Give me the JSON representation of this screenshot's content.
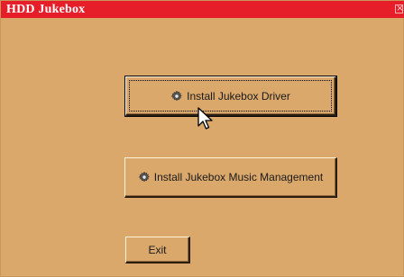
{
  "window": {
    "title": "HDD Jukebox",
    "close_glyph": "×"
  },
  "buttons": {
    "driver": {
      "label": "Install Jukebox Driver",
      "icon": "gear-icon"
    },
    "music": {
      "label": "Install Jukebox Music Management",
      "icon": "gear-icon"
    },
    "exit": {
      "label": "Exit"
    }
  },
  "colors": {
    "titlebar": "#e61e2a",
    "background": "#dba86c"
  }
}
